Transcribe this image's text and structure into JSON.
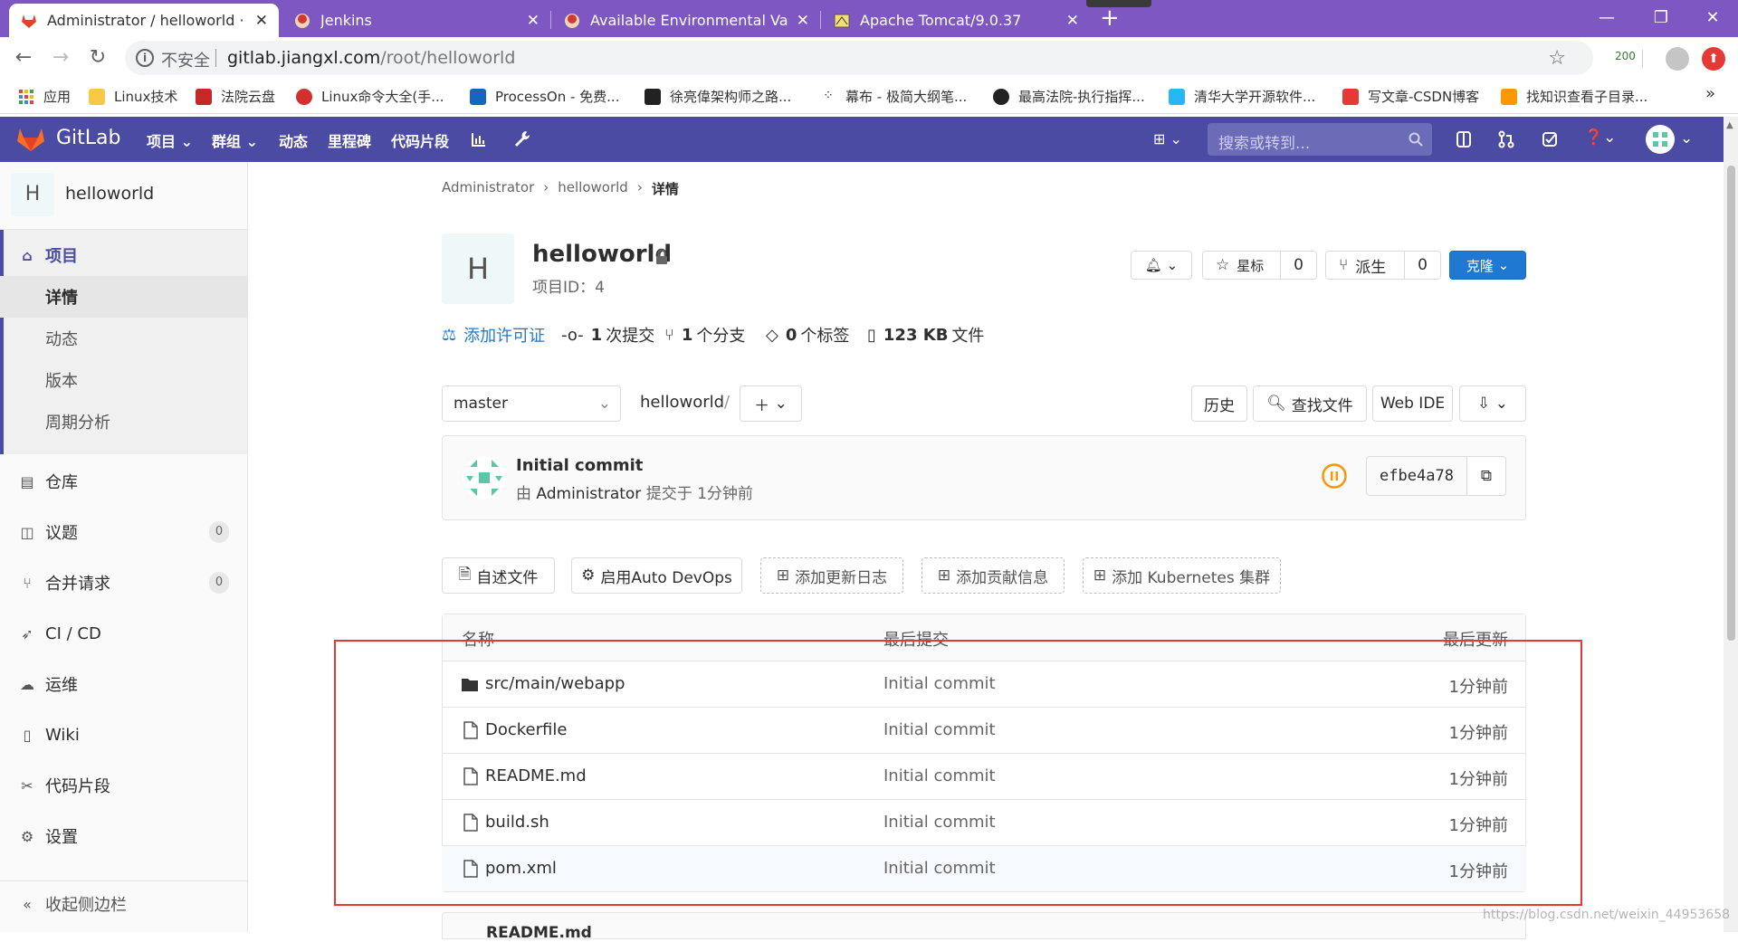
{
  "browser": {
    "tabs": [
      {
        "title": "Administrator / helloworld · Gi",
        "active": true
      },
      {
        "title": "Jenkins",
        "active": false
      },
      {
        "title": "Available Environmental Variat",
        "active": false
      },
      {
        "title": "Apache Tomcat/9.0.37",
        "active": false
      }
    ],
    "new_tab": "+",
    "address": {
      "insecure_label": "不安全",
      "host": "gitlab.jiangxl.com",
      "path": "/root/helloworld"
    },
    "ext_badge": "200",
    "bookmarks": [
      "应用",
      "Linux技术",
      "法院云盘",
      "Linux命令大全(手...",
      "ProcessOn - 免费...",
      "徐亮偉架构师之路...",
      "幕布 - 极简大纲笔...",
      "最高法院-执行指挥...",
      "清华大学开源软件...",
      "写文章-CSDN博客",
      "找知识查看子目录..."
    ],
    "more_bookmarks": "»"
  },
  "gitlab": {
    "brand": "GitLab",
    "nav": [
      "项目",
      "群组",
      "动态",
      "里程碑",
      "代码片段"
    ],
    "search_placeholder": "搜索或转到..."
  },
  "sidebar": {
    "project_letter": "H",
    "project_name": "helloworld",
    "section": "项目",
    "subitems": [
      "详情",
      "动态",
      "版本",
      "周期分析"
    ],
    "items": [
      {
        "label": "仓库",
        "icon": "repo-icon",
        "count": ""
      },
      {
        "label": "议题",
        "icon": "issues-icon",
        "count": "0"
      },
      {
        "label": "合并请求",
        "icon": "merge-request-icon",
        "count": "0"
      },
      {
        "label": "CI / CD",
        "icon": "rocket-icon",
        "count": ""
      },
      {
        "label": "运维",
        "icon": "cloud-gear-icon",
        "count": ""
      },
      {
        "label": "Wiki",
        "icon": "book-icon",
        "count": ""
      },
      {
        "label": "代码片段",
        "icon": "scissors-icon",
        "count": ""
      },
      {
        "label": "设置",
        "icon": "gear-icon",
        "count": ""
      }
    ],
    "collapse": "收起侧边栏"
  },
  "breadcrumb": [
    "Administrator",
    "helloworld",
    "详情"
  ],
  "project": {
    "letter": "H",
    "name": "helloworld",
    "id_label": "项目ID：4",
    "star_label": "星标",
    "star_count": "0",
    "fork_label": "派生",
    "fork_count": "0",
    "clone_label": "克隆",
    "stats": {
      "license": "添加许可证",
      "commits_num": "1",
      "commits_label": "次提交",
      "branches_num": "1",
      "branches_label": "个分支",
      "tags_num": "0",
      "tags_label": "个标签",
      "size_num": "123 KB",
      "size_label": "文件"
    }
  },
  "repo": {
    "branch": "master",
    "path": "helloworld",
    "path_sep": "/",
    "history": "历史",
    "find_file": "查找文件",
    "web_ide": "Web IDE",
    "commit_title": "Initial commit",
    "commit_by": "由",
    "commit_author": "Administrator",
    "commit_time": "提交于 1分钟前",
    "commit_sha": "efbe4a78",
    "actions": [
      "自述文件",
      "启用Auto DevOps",
      "添加更新日志",
      "添加贡献信息",
      "添加 Kubernetes 集群"
    ],
    "table_headers": [
      "名称",
      "最后提交",
      "最后更新"
    ],
    "files": [
      {
        "name": "src/main/webapp",
        "type": "folder",
        "commit": "Initial commit",
        "updated": "1分钟前"
      },
      {
        "name": "Dockerfile",
        "type": "file",
        "commit": "Initial commit",
        "updated": "1分钟前"
      },
      {
        "name": "README.md",
        "type": "file",
        "commit": "Initial commit",
        "updated": "1分钟前"
      },
      {
        "name": "build.sh",
        "type": "file",
        "commit": "Initial commit",
        "updated": "1分钟前"
      },
      {
        "name": "pom.xml",
        "type": "file",
        "commit": "Initial commit",
        "updated": "1分钟前"
      }
    ],
    "readme_peek": "README.md"
  },
  "watermark": "https://blog.csdn.net/weixin_44953658",
  "colors": {
    "gitlab_purple": "#4b4ba3",
    "chrome_purple": "#7e57c2",
    "highlight_box": "#e53935",
    "clone_blue": "#1f78d1"
  }
}
